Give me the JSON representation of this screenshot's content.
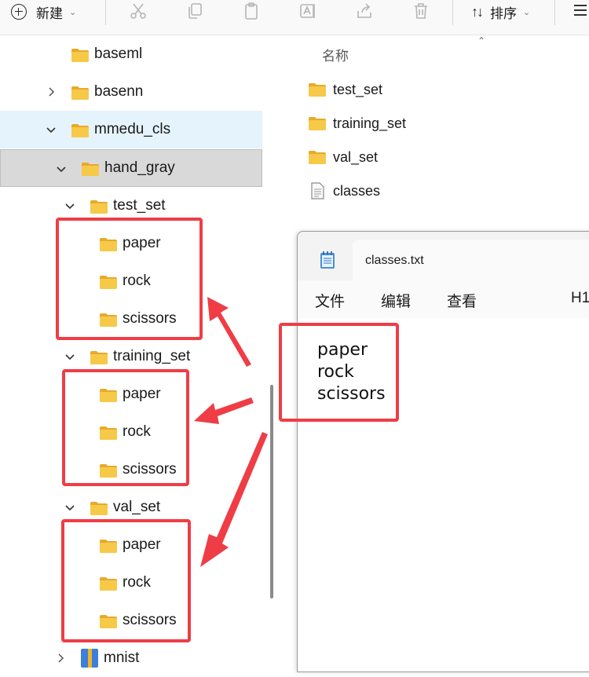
{
  "toolbar": {
    "new_label": "新建",
    "sort_label": "排序",
    "icons": [
      "cut-icon",
      "copy-icon",
      "paste-icon",
      "rename-icon",
      "share-icon",
      "delete-icon"
    ]
  },
  "tree": {
    "items": [
      {
        "label": "baseml"
      },
      {
        "label": "basenn"
      },
      {
        "label": "mmedu_cls"
      },
      {
        "label": "hand_gray"
      },
      {
        "label": "test_set"
      },
      {
        "label": "paper"
      },
      {
        "label": "rock"
      },
      {
        "label": "scissors"
      },
      {
        "label": "training_set"
      },
      {
        "label": "paper"
      },
      {
        "label": "rock"
      },
      {
        "label": "scissors"
      },
      {
        "label": "val_set"
      },
      {
        "label": "paper"
      },
      {
        "label": "rock"
      },
      {
        "label": "scissors"
      },
      {
        "label": "mnist"
      }
    ]
  },
  "files": {
    "column_name": "名称",
    "items": [
      {
        "label": "test_set",
        "type": "folder"
      },
      {
        "label": "training_set",
        "type": "folder"
      },
      {
        "label": "val_set",
        "type": "folder"
      },
      {
        "label": "classes",
        "type": "file"
      }
    ]
  },
  "notepad": {
    "title": "classes.txt",
    "menu": [
      "文件",
      "编辑",
      "查看",
      "H1"
    ],
    "lines": [
      "paper",
      "rock",
      "scissors"
    ]
  },
  "colors": {
    "annotation": "#ef3d46",
    "folder": "#f6c343",
    "selection": "#e5f3fd"
  }
}
